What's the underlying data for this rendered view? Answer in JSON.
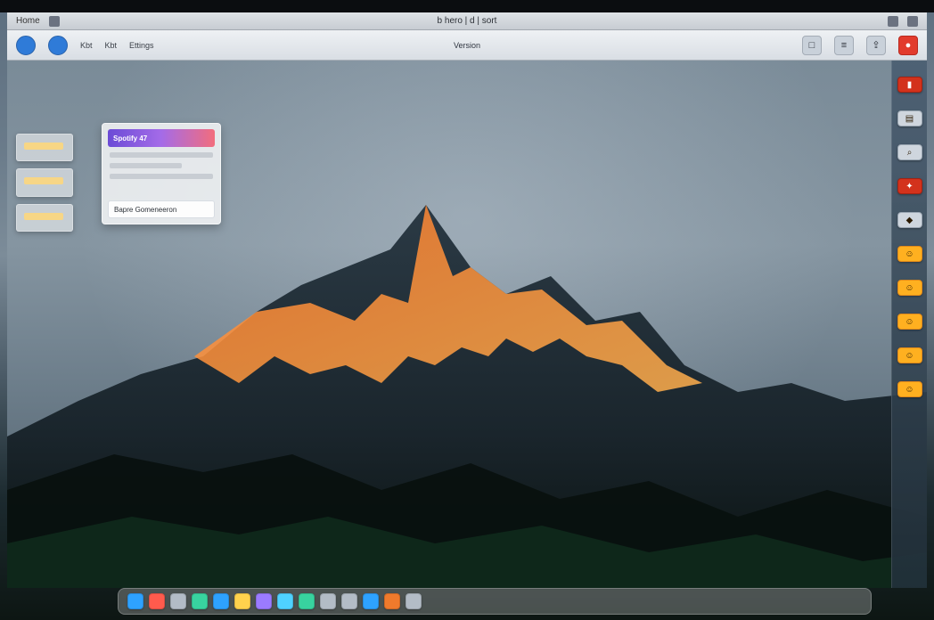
{
  "window": {
    "left_label": "Home",
    "title": "b hero | d | sort",
    "icons": [
      "apple-menu-icon",
      "wifi-icon",
      "battery-icon"
    ]
  },
  "toolbar": {
    "left_text_1": "Kbt",
    "left_text_2": "Kbt",
    "left_text_3": "Ettings",
    "center_text": "Version"
  },
  "widget": {
    "header": "Spotify 47",
    "footer": "Bapre Gomeneeron"
  },
  "right_dock": {
    "items": [
      {
        "icon": "pin-icon",
        "variant": "red"
      },
      {
        "icon": "note-icon",
        "variant": "grey"
      },
      {
        "icon": "search-icon",
        "variant": "grey"
      },
      {
        "icon": "bird-icon",
        "variant": "red"
      },
      {
        "icon": "rock-icon",
        "variant": "grey"
      },
      {
        "icon": "smile-icon",
        "variant": "amber"
      },
      {
        "icon": "smile-icon",
        "variant": "amber"
      },
      {
        "icon": "smile-icon",
        "variant": "amber"
      },
      {
        "icon": "smile-icon",
        "variant": "amber"
      },
      {
        "icon": "smile-icon",
        "variant": "amber"
      }
    ]
  },
  "bottom_dock": {
    "apps": [
      {
        "name": "finder-app",
        "color": "c2"
      },
      {
        "name": "calendar-app",
        "color": "c1"
      },
      {
        "name": "notes-app",
        "color": "c7"
      },
      {
        "name": "messages-app",
        "color": "c3"
      },
      {
        "name": "mail-app",
        "color": "c2"
      },
      {
        "name": "photos-app",
        "color": "c4"
      },
      {
        "name": "music-app",
        "color": "c5"
      },
      {
        "name": "safari-app",
        "color": "c6"
      },
      {
        "name": "maps-app",
        "color": "c3"
      },
      {
        "name": "terminal-app",
        "color": "c7"
      },
      {
        "name": "settings-app",
        "color": "c7"
      },
      {
        "name": "store-app",
        "color": "c2"
      },
      {
        "name": "files-app",
        "color": "c8"
      },
      {
        "name": "trash-app",
        "color": "c7"
      }
    ]
  }
}
